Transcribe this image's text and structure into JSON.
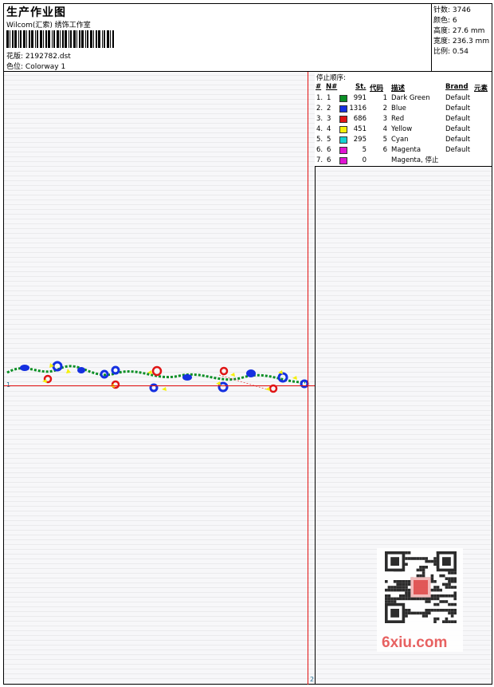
{
  "header": {
    "title": "生产作业图",
    "subtitle": "Wilcom(汇索) 绣饰工作室",
    "filename_label": "花版:",
    "filename": "2192782.dst",
    "colorway_label": "色位:",
    "colorway": "Colorway 1"
  },
  "stats": [
    {
      "label": "针数:",
      "value": "3746"
    },
    {
      "label": "颜色:",
      "value": "6"
    },
    {
      "label": "高度:",
      "value": "27.6 mm"
    },
    {
      "label": "宽度:",
      "value": "236.3 mm"
    },
    {
      "label": "比例:",
      "value": "0.54"
    }
  ],
  "stop_sequence": {
    "title": "停止顺序:",
    "columns": [
      "#",
      "N#",
      "St.",
      "代码",
      "描述",
      "Brand",
      "元素"
    ],
    "rows": [
      {
        "num": "1.",
        "n": "1",
        "color": "#0b8f25",
        "st": "991",
        "code": "1",
        "desc": "Dark Green",
        "brand": "Default"
      },
      {
        "num": "2.",
        "n": "2",
        "color": "#1530e0",
        "st": "1316",
        "code": "2",
        "desc": "Blue",
        "brand": "Default"
      },
      {
        "num": "3.",
        "n": "3",
        "color": "#e01515",
        "st": "686",
        "code": "3",
        "desc": "Red",
        "brand": "Default"
      },
      {
        "num": "4.",
        "n": "4",
        "color": "#f5f00a",
        "st": "451",
        "code": "4",
        "desc": "Yellow",
        "brand": "Default"
      },
      {
        "num": "5.",
        "n": "5",
        "color": "#14d2d2",
        "st": "295",
        "code": "5",
        "desc": "Cyan",
        "brand": "Default"
      },
      {
        "num": "6.",
        "n": "6",
        "color": "#e014d2",
        "st": "5",
        "code": "6",
        "desc": "Magenta",
        "brand": "Default"
      },
      {
        "num": "7.",
        "n": "6",
        "color": "#e014d2",
        "st": "0",
        "code": "",
        "desc": "Magenta, 停止",
        "brand": ""
      }
    ]
  },
  "watermark": {
    "text": "6xiu.com"
  },
  "markers": {
    "left": "1",
    "bottom": "2"
  }
}
